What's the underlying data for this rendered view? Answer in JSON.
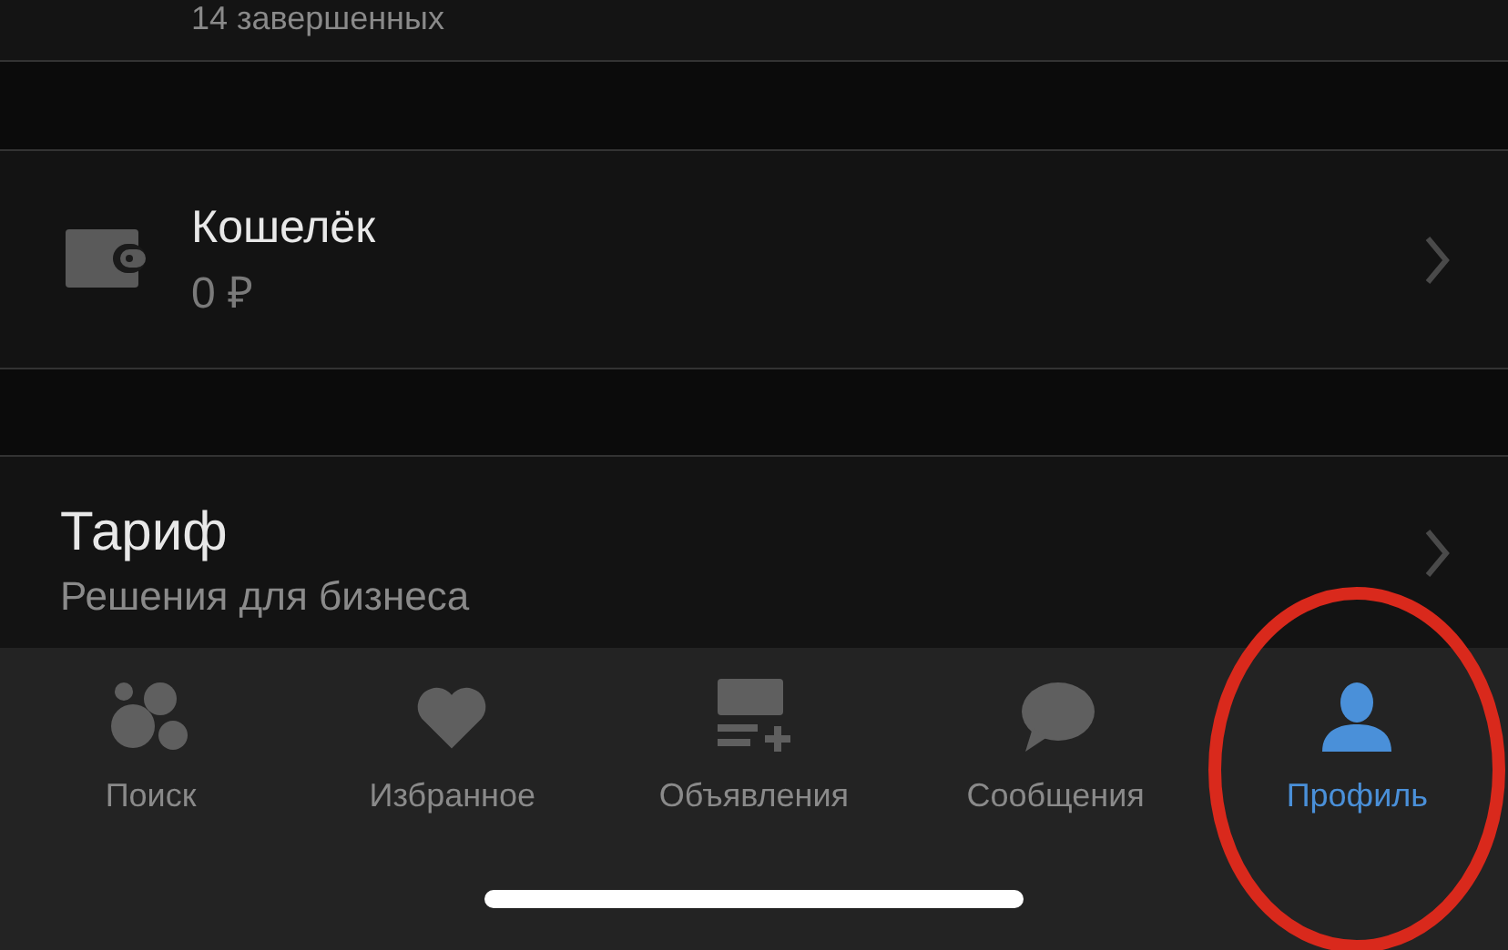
{
  "top_row": {
    "subtitle": "14 завершенных"
  },
  "wallet": {
    "title": "Кошелёк",
    "balance": "0 ₽"
  },
  "tariff": {
    "title": "Тариф",
    "subtitle": "Решения для бизнеса"
  },
  "tab_bar": [
    {
      "kind": "search",
      "label": "Поиск",
      "selected": false
    },
    {
      "kind": "favorites",
      "label": "Избранное",
      "selected": false
    },
    {
      "kind": "listings",
      "label": "Объявления",
      "selected": false
    },
    {
      "kind": "messages",
      "label": "Сообщения",
      "selected": false
    },
    {
      "kind": "profile",
      "label": "Профиль",
      "selected": true
    }
  ],
  "annotation": {
    "kind": "ellipse",
    "color": "#d9291c"
  }
}
